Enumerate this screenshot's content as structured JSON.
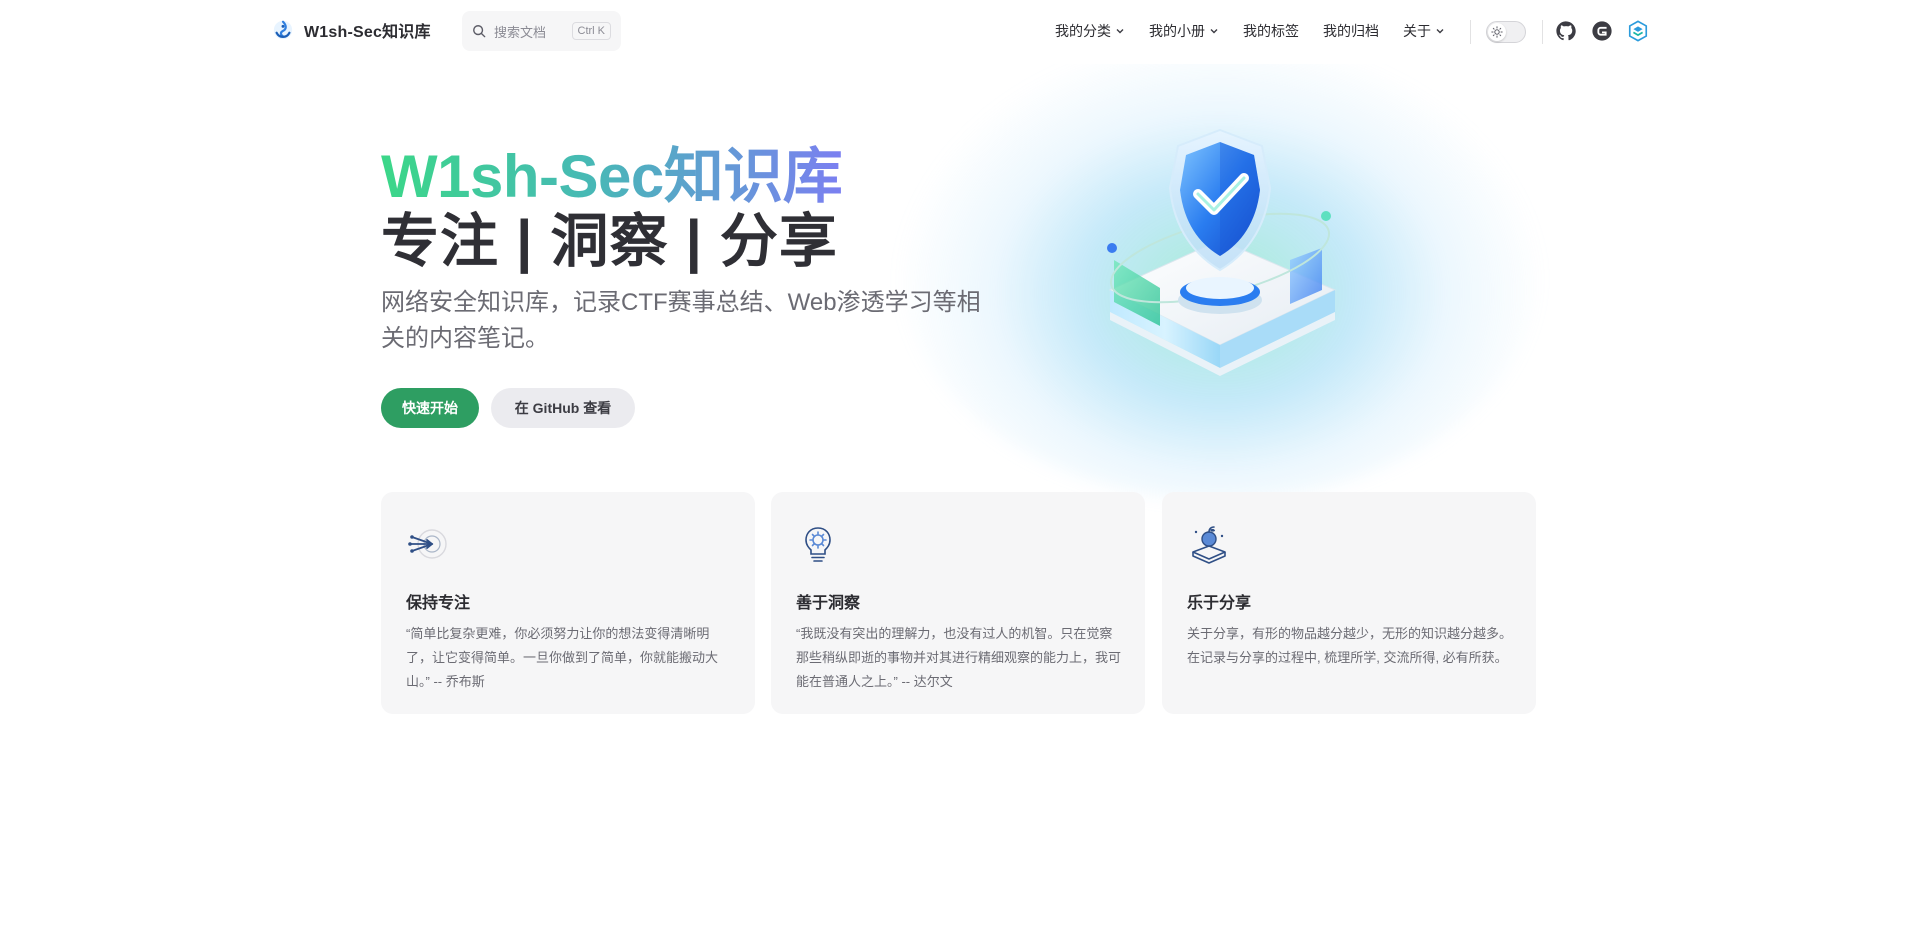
{
  "nav": {
    "brand": "W1sh-Sec知识库",
    "search": {
      "placeholder": "搜索文档",
      "shortcut": "Ctrl K"
    },
    "links": [
      {
        "label": "我的分类",
        "dropdown": true
      },
      {
        "label": "我的小册",
        "dropdown": true
      },
      {
        "label": "我的标签",
        "dropdown": false
      },
      {
        "label": "我的归档",
        "dropdown": false
      },
      {
        "label": "关于",
        "dropdown": true
      }
    ],
    "social": [
      "github-icon",
      "gitee-icon",
      "blog-icon"
    ]
  },
  "hero": {
    "name": "W1sh-Sec知识库",
    "tagline": "专注 | 洞察 | 分享",
    "description": "网络安全知识库，记录CTF赛事总结、Web渗透学习等相关的内容笔记。",
    "actions": {
      "primary": "快速开始",
      "secondary": "在 GitHub 查看"
    }
  },
  "features": [
    {
      "icon": "focus-arrows-icon",
      "title": "保持专注",
      "details": "“简单比复杂更难，你必须努力让你的想法变得清晰明了，让它变得简单。一旦你做到了简单，你就能搬动大山。” -- 乔布斯"
    },
    {
      "icon": "lightbulb-icon",
      "title": "善于洞察",
      "details": "“我既没有突出的理解力，也没有过人的机智。只在觉察那些稍纵即逝的事物并对其进行精细观察的能力上，我可能在普通人之上。” -- 达尔文"
    },
    {
      "icon": "apple-book-icon",
      "title": "乐于分享",
      "details": "关于分享，有形的物品越分越少，无形的知识越分越多。在记录与分享的过程中, 梳理所学, 交流所得, 必有所获。"
    }
  ],
  "colors": {
    "brand_green": "#2e9e62",
    "gradient_start": "#3bd788",
    "gradient_end": "#7b7ff1",
    "card_bg": "#f6f6f7"
  }
}
